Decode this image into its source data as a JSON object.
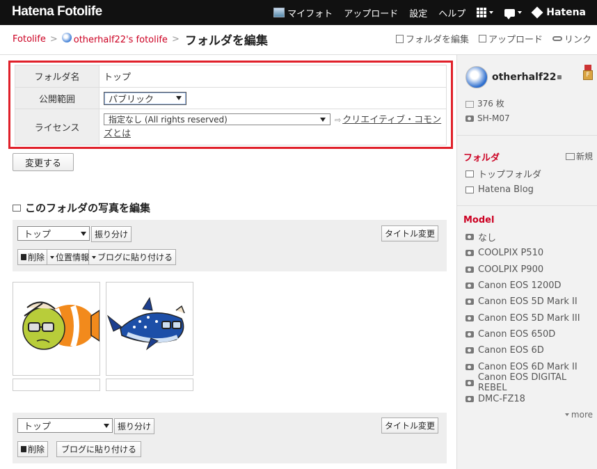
{
  "header": {
    "logo": "Hatena Fotolife",
    "nav": [
      "マイフォト",
      "アップロード",
      "設定",
      "ヘルプ"
    ],
    "brand": "Hatena"
  },
  "breadcrumb": {
    "root": "Fotolife",
    "user": "otherhalf22's fotolife",
    "title": "フォルダを編集"
  },
  "actions": {
    "edit_folder": "フォルダを編集",
    "upload": "アップロード",
    "link": "リンク"
  },
  "form": {
    "folder_name_label": "フォルダ名",
    "folder_name_value": "トップ",
    "visibility_label": "公開範囲",
    "visibility_value": "パブリック",
    "license_label": "ライセンス",
    "license_value": "指定なし (All rights reserved)",
    "license_link_1": "クリエイティブ・コモン",
    "license_link_2": "ズとは",
    "submit": "変更する"
  },
  "photos_section": {
    "title": "このフォルダの写真を編集",
    "folder_select": "トップ",
    "sort_button": "振り分け",
    "title_change": "タイトル変更",
    "delete": "削除",
    "location": "位置情報",
    "paste_blog": "ブログに貼り付ける"
  },
  "sidebar": {
    "username": "otherhalf22",
    "badge": "F",
    "photo_count": "376 枚",
    "camera": "SH-M07",
    "folders_heading": "フォルダ",
    "new_folder": "新規",
    "folders": [
      "トップフォルダ",
      "Hatena Blog"
    ],
    "model_heading": "Model",
    "models": [
      "なし",
      "COOLPIX P510",
      "COOLPIX P900",
      "Canon EOS 1200D",
      "Canon EOS 5D Mark II",
      "Canon EOS 5D Mark III",
      "Canon EOS 650D",
      "Canon EOS 6D",
      "Canon EOS 6D Mark II",
      "Canon EOS DIGITAL REBEL",
      "DMC-FZ18"
    ],
    "more": "more"
  }
}
